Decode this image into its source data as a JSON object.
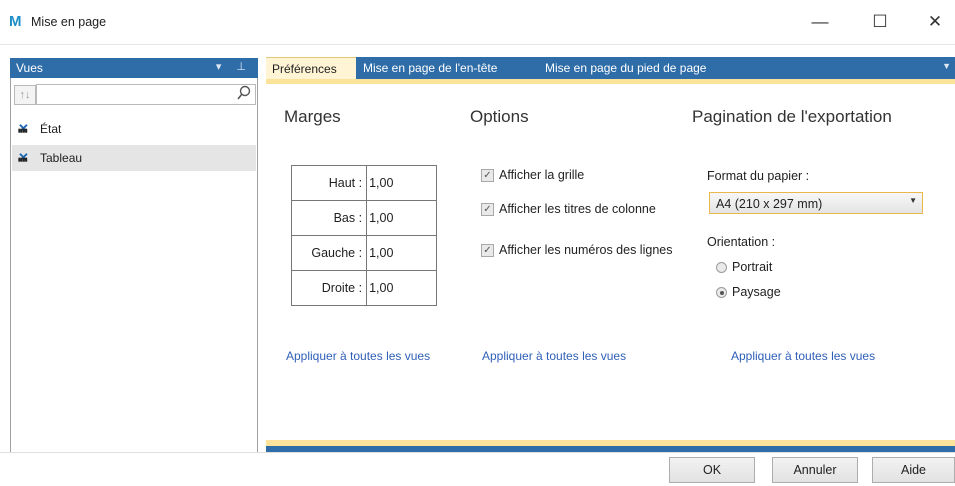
{
  "window": {
    "title": "Mise en page",
    "app_icon": "M",
    "minimize_glyph": "—",
    "maximize_glyph": "☐",
    "close_glyph": "✕"
  },
  "views_pane": {
    "title": "Vues",
    "tools": "▾ ⊥",
    "sort_glyph": "↑↓",
    "search": {
      "value": "",
      "placeholder": ""
    },
    "items": [
      {
        "label": "État",
        "selected": false
      },
      {
        "label": "Tableau",
        "selected": true
      }
    ]
  },
  "tabs": [
    {
      "label": "Préférences",
      "active": true
    },
    {
      "label": "Mise en page de l'en-tête",
      "active": false
    },
    {
      "label": "Mise en page du pied de page",
      "active": false
    }
  ],
  "margins": {
    "title": "Marges",
    "rows": [
      {
        "label": "Haut :",
        "value": "1,00"
      },
      {
        "label": "Bas :",
        "value": "1,00"
      },
      {
        "label": "Gauche :",
        "value": "1,00"
      },
      {
        "label": "Droite :",
        "value": "1,00"
      }
    ],
    "apply_link": "Appliquer à toutes les vues"
  },
  "options": {
    "title": "Options",
    "checkboxes": [
      {
        "label": "Afficher la grille",
        "checked": true
      },
      {
        "label": "Afficher les titres de colonne",
        "checked": true
      },
      {
        "label": "Afficher les numéros des lignes",
        "checked": true
      }
    ],
    "apply_link": "Appliquer à toutes les vues"
  },
  "export": {
    "title": "Pagination de l'exportation",
    "paper_label": "Format du papier :",
    "paper_value": "A4 (210 x 297 mm)",
    "orientation_label": "Orientation :",
    "orientation_options": [
      {
        "label": "Portrait",
        "selected": false
      },
      {
        "label": "Paysage",
        "selected": true
      }
    ],
    "apply_link": "Appliquer à toutes les vues"
  },
  "footer": {
    "ok": "OK",
    "cancel": "Annuler",
    "help": "Aide"
  },
  "colors": {
    "accent_blue": "#2f6da9",
    "tab_gold": "#fce39b",
    "link": "#2f5fb7"
  }
}
